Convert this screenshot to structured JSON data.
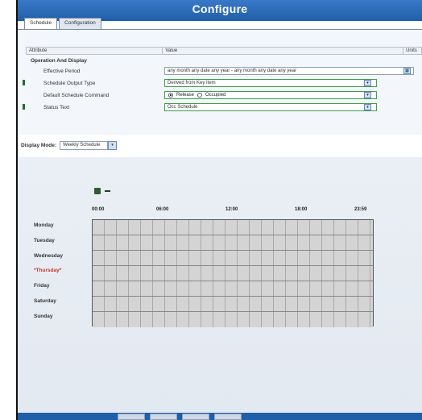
{
  "window": {
    "title": "Configure"
  },
  "tabs": [
    {
      "label": "Schedule"
    },
    {
      "label": "Configuration"
    }
  ],
  "table": {
    "headers": {
      "attribute": "Attribute",
      "value": "Value",
      "units": "Units"
    },
    "group_label": "Operation And Display",
    "rows": [
      {
        "attribute": "Effective Period",
        "value": "any month any date any year - any month any date any year"
      },
      {
        "attribute": "Schedule Output Type",
        "value": "Derived from Key Item"
      },
      {
        "attribute": "Default Schedule Command",
        "options": [
          "Release",
          "Occupied"
        ],
        "selected": "Release"
      },
      {
        "attribute": "Status Text",
        "value": "Occ Schedule"
      }
    ]
  },
  "display_mode": {
    "label": "Display Mode:",
    "value": "Weekly Schedule"
  },
  "schedule": {
    "times": [
      "00:00",
      "06:00",
      "12:00",
      "18:00",
      "23:59"
    ],
    "days": [
      "Monday",
      "Tuesday",
      "Wednesday",
      "*Thursday*",
      "Friday",
      "Saturday",
      "Sunday"
    ]
  },
  "icons": {
    "calendar": "calendar-icon",
    "minus": "minus-icon",
    "dropdown": "chevron-down-icon"
  },
  "colors": {
    "title_bar": "#1f5ea8",
    "accent_green": "#3aa04a",
    "today": "#c0392b"
  }
}
